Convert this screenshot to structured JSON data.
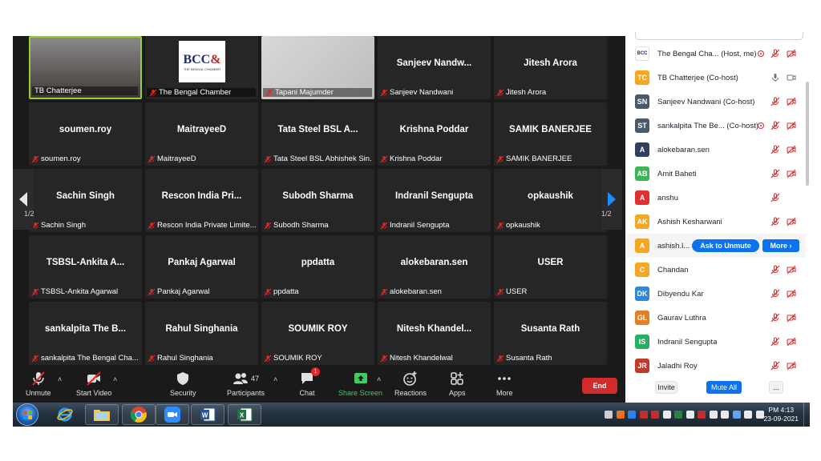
{
  "video_tiles": [
    {
      "center": "",
      "label": "TB Chatterjee",
      "muted": false,
      "kind": "photo-person",
      "active": true
    },
    {
      "center": "",
      "label": "The Bengal Chamber",
      "muted": true,
      "kind": "logo"
    },
    {
      "center": "",
      "label": "Tapani Majumder",
      "muted": true,
      "kind": "photo-wall"
    },
    {
      "center": "Sanjeev  Nandw...",
      "label": "Sanjeev Nandwani",
      "muted": true
    },
    {
      "center": "Jitesh Arora",
      "label": "Jitesh Arora",
      "muted": true
    },
    {
      "center": "soumen.roy",
      "label": "soumen.roy",
      "muted": true
    },
    {
      "center": "MaitrayeeD",
      "label": "MaitrayeeD",
      "muted": true
    },
    {
      "center": "Tata Steel BSL  A...",
      "label": "Tata Steel BSL Abhishek Sin...",
      "muted": true
    },
    {
      "center": "Krishna Poddar",
      "label": "Krishna Poddar",
      "muted": true
    },
    {
      "center": "SAMIK BANERJEE",
      "label": "SAMIK BANERJEE",
      "muted": true
    },
    {
      "center": "Sachin Singh",
      "label": "Sachin Singh",
      "muted": true
    },
    {
      "center": "Rescon India  Pri...",
      "label": "Rescon India Private Limite...",
      "muted": true
    },
    {
      "center": "Subodh Sharma",
      "label": "Subodh Sharma",
      "muted": true
    },
    {
      "center": "Indranil Sengupta",
      "label": "Indranil Sengupta",
      "muted": true
    },
    {
      "center": "opkaushik",
      "label": "opkaushik",
      "muted": true
    },
    {
      "center": "TSBSL-Ankita  A...",
      "label": "TSBSL-Ankita Agarwal",
      "muted": true
    },
    {
      "center": "Pankaj Agarwal",
      "label": "Pankaj Agarwal",
      "muted": true
    },
    {
      "center": "ppdatta",
      "label": "ppdatta",
      "muted": true
    },
    {
      "center": "alokebaran.sen",
      "label": "alokebaran.sen",
      "muted": true
    },
    {
      "center": "USER",
      "label": "USER",
      "muted": true
    },
    {
      "center": "sankalpita  The  B...",
      "label": "sankalpita The Bengal Cha...",
      "muted": true
    },
    {
      "center": "Rahul Singhania",
      "label": "Rahul Singhania",
      "muted": true
    },
    {
      "center": "SOUMIK ROY",
      "label": "SOUMIK ROY",
      "muted": true
    },
    {
      "center": "Nitesh  Khandel...",
      "label": "Nitesh Khandelwal",
      "muted": true
    },
    {
      "center": "Susanta Rath",
      "label": "Susanta Rath",
      "muted": true
    }
  ],
  "logo": {
    "main": "BCC",
    "amp": "&",
    "sub": "THE BENGAL CHAMBER"
  },
  "pagination": {
    "left": "1/2",
    "right": "1/2"
  },
  "toolbar": {
    "unmute": "Unmute",
    "start_video": "Start Video",
    "security": "Security",
    "participants": "Participants",
    "participants_count": "47",
    "chat": "Chat",
    "chat_badge": "1",
    "share_screen": "Share Screen",
    "reactions": "Reactions",
    "apps": "Apps",
    "more": "More",
    "end": "End"
  },
  "participants": [
    {
      "initials": "",
      "color": "#ffffff",
      "name": "The Bengal Cha...  (Host, me)",
      "rec": true,
      "mic": "muted",
      "video": "off",
      "logo": true
    },
    {
      "initials": "TC",
      "color": "#f5a623",
      "name": "TB Chatterjee (Co-host)",
      "rec": false,
      "mic": "on",
      "video": "on"
    },
    {
      "initials": "SN",
      "color": "#4a5a6a",
      "name": "Sanjeev Nandwani (Co-host)",
      "rec": false,
      "mic": "muted",
      "video": "off"
    },
    {
      "initials": "ST",
      "color": "#4a5a6a",
      "name": "sankalpita The Be... (Co-host)",
      "rec": true,
      "mic": "muted",
      "video": "off"
    },
    {
      "initials": "A",
      "color": "#2f3f5f",
      "name": "alokebaran.sen",
      "rec": false,
      "mic": "muted",
      "video": "off"
    },
    {
      "initials": "AB",
      "color": "#3db556",
      "name": "Amit Baheti",
      "rec": false,
      "mic": "muted",
      "video": "off"
    },
    {
      "initials": "A",
      "color": "#e0302f",
      "name": "anshu",
      "rec": false,
      "mic": "muted",
      "video": "none"
    },
    {
      "initials": "AK",
      "color": "#f5a623",
      "name": "Ashish Kesharwani",
      "rec": false,
      "mic": "muted",
      "video": "off"
    },
    {
      "initials": "A",
      "color": "#f5a623",
      "name": "ashish.l...",
      "rec": false,
      "mic": "none",
      "video": "none",
      "hover": true
    },
    {
      "initials": "C",
      "color": "#f5a623",
      "name": "Chandan",
      "rec": false,
      "mic": "muted",
      "video": "off"
    },
    {
      "initials": "DK",
      "color": "#2e88d6",
      "name": "Dibyendu Kar",
      "rec": false,
      "mic": "muted",
      "video": "off"
    },
    {
      "initials": "GL",
      "color": "#e67e22",
      "name": "Gaurav Luthra",
      "rec": false,
      "mic": "muted",
      "video": "off"
    },
    {
      "initials": "IS",
      "color": "#27ae60",
      "name": "Indranil Sengupta",
      "rec": false,
      "mic": "muted",
      "video": "off"
    },
    {
      "initials": "JR",
      "color": "#c0392b",
      "name": "Jaladhi Roy",
      "rec": false,
      "mic": "muted",
      "video": "off"
    }
  ],
  "hover_actions": {
    "ask_unmute": "Ask to Unmute",
    "more": "More ›"
  },
  "panel_footer": {
    "invite": "Invite",
    "mute_all": "Mute All",
    "more": "..."
  },
  "taskbar": {
    "time": "PM 4:13",
    "date": "23-09-2021"
  },
  "colors": {
    "zoom_blue": "#0e72ed",
    "mute_red": "#e02828",
    "end_red": "#d22b2b",
    "share_green": "#3fce5d"
  }
}
